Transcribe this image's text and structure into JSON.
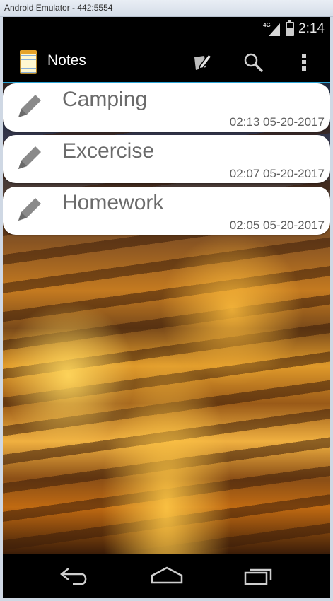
{
  "window": {
    "title": "Android Emulator - 442:5554"
  },
  "status_bar": {
    "network_label": "4G",
    "time": "2:14"
  },
  "action_bar": {
    "title": "Notes",
    "actions": [
      {
        "name": "compose",
        "icon": "compose-icon"
      },
      {
        "name": "search",
        "icon": "search-icon"
      },
      {
        "name": "overflow",
        "icon": "overflow-menu-icon"
      }
    ]
  },
  "notes": [
    {
      "title": "Camping",
      "timestamp": "02:13 05-20-2017",
      "icon": "pencil-icon"
    },
    {
      "title": "Excercise",
      "timestamp": "02:07 05-20-2017",
      "icon": "pencil-icon"
    },
    {
      "title": "Homework",
      "timestamp": "02:05 05-20-2017",
      "icon": "pencil-icon"
    }
  ],
  "nav_bar": {
    "buttons": [
      "back",
      "home",
      "recents"
    ]
  },
  "colors": {
    "accent": "#2aa4d6",
    "background": "#000000",
    "card": "#ffffff",
    "text_gray": "#6b6b6b"
  }
}
